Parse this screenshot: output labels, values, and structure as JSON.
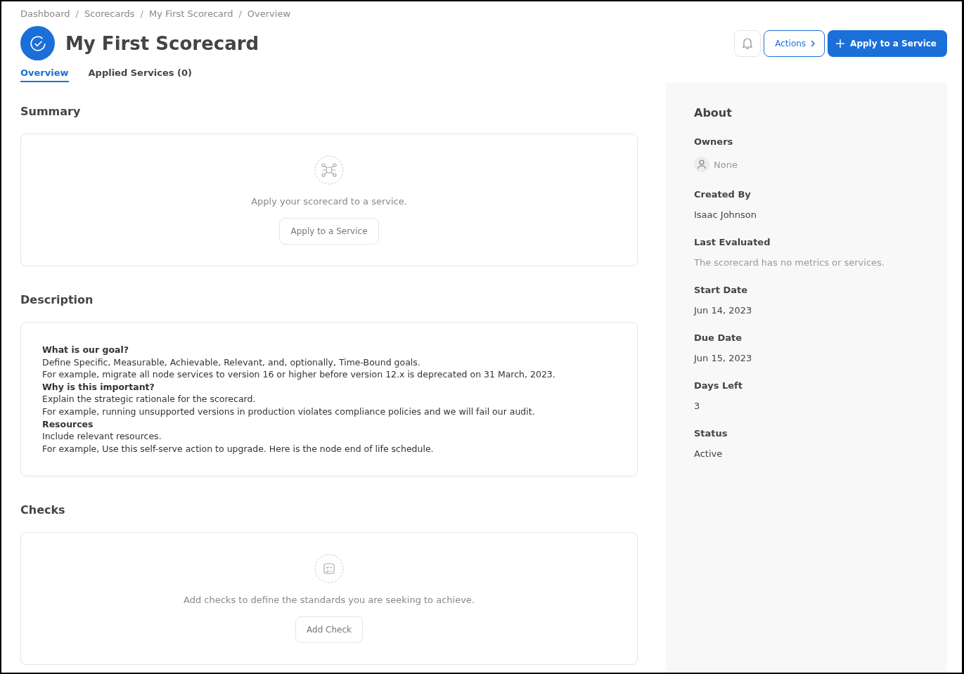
{
  "breadcrumbs": [
    "Dashboard",
    "Scorecards",
    "My First Scorecard",
    "Overview"
  ],
  "breadcrumb_separators": [
    "/",
    "/",
    "/"
  ],
  "title": "My First Scorecard",
  "header_buttons": {
    "actions": "Actions",
    "apply": "Apply to a Service"
  },
  "tabs": [
    {
      "label": "Overview",
      "selected": true
    },
    {
      "label": "Applied Services (0)",
      "selected": false
    }
  ],
  "summary": {
    "heading": "Summary",
    "message": "Apply your scorecard to a service.",
    "button": "Apply to a Service"
  },
  "description": {
    "heading": "Description",
    "lines": [
      {
        "kind": "heading",
        "text": "What is our goal?"
      },
      {
        "kind": "text",
        "text": "Define Specific, Measurable, Achievable, Relevant, and, optionally, Time-Bound goals."
      },
      {
        "kind": "text",
        "text": "For example, migrate all node services to version 16 or higher before version 12.x is deprecated on 31 March, 2023."
      },
      {
        "kind": "heading",
        "text": "Why is this important?"
      },
      {
        "kind": "text",
        "text": "Explain the strategic rationale for the scorecard."
      },
      {
        "kind": "text",
        "text": "For example, running unsupported versions in production violates compliance policies and we will fail our audit."
      },
      {
        "kind": "heading",
        "text": "Resources"
      },
      {
        "kind": "text",
        "text": "Include relevant resources."
      },
      {
        "kind": "text",
        "text": "For example, Use this self-serve action to upgrade. Here is the node end of life schedule."
      }
    ]
  },
  "checks": {
    "heading": "Checks",
    "message": "Add checks to define the standards you are seeking to achieve.",
    "button": "Add Check"
  },
  "about": {
    "heading": "About",
    "fields": [
      {
        "label": "Owners",
        "value": "None",
        "kind": "owner",
        "muted": true
      },
      {
        "label": "Created By",
        "value": "Isaac Johnson",
        "kind": "text",
        "muted": false
      },
      {
        "label": "Last Evaluated",
        "value": "The scorecard has no metrics or services.",
        "kind": "text",
        "muted": true
      },
      {
        "label": "Start Date",
        "value": "Jun 14, 2023",
        "kind": "text",
        "muted": false
      },
      {
        "label": "Due Date",
        "value": "Jun 15, 2023",
        "kind": "text",
        "muted": false
      },
      {
        "label": "Days Left",
        "value": "3",
        "kind": "text",
        "muted": false
      },
      {
        "label": "Status",
        "value": "Active",
        "kind": "text",
        "muted": false
      }
    ]
  }
}
